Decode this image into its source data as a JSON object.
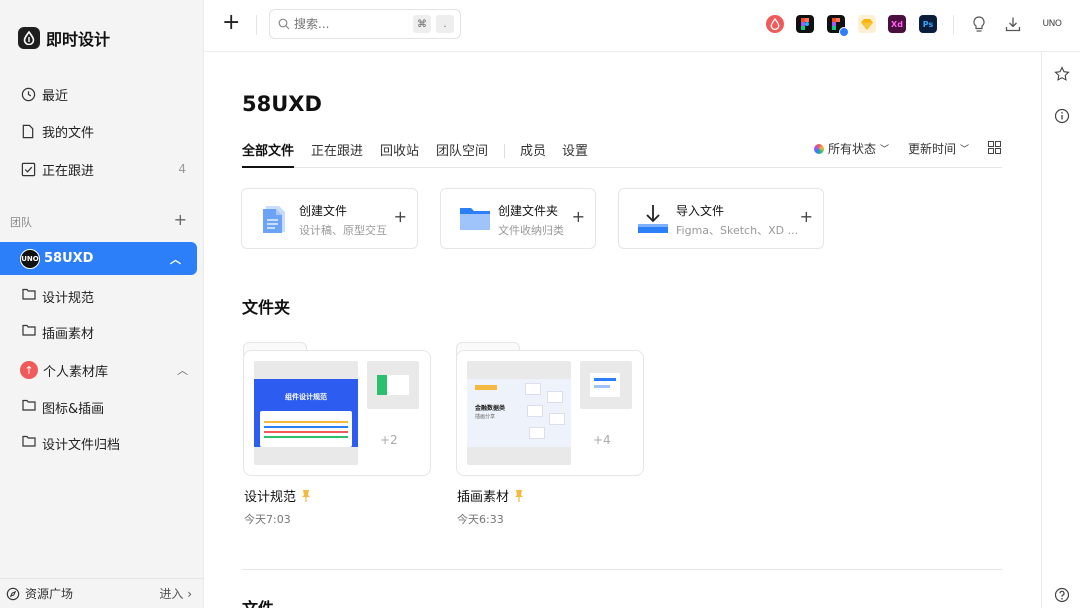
{
  "brand": {
    "name": "即时设计",
    "logo_icon": "drop-logo-icon"
  },
  "sidebar": {
    "nav": [
      {
        "label": "最近",
        "icon": "clock-icon"
      },
      {
        "label": "我的文件",
        "icon": "file-icon"
      },
      {
        "label": "正在跟进",
        "icon": "checkbox-icon",
        "count": "4"
      }
    ],
    "team_section_label": "团队",
    "team": {
      "name": "58UXD",
      "badge": "UNO"
    },
    "team_folders": [
      "设计规范",
      "插画素材"
    ],
    "personal": {
      "name": "个人素材库"
    },
    "personal_folders": [
      "图标&插画",
      "设计文件归档"
    ],
    "footer": {
      "label": "资源广场",
      "enter": "进入"
    }
  },
  "topbar": {
    "search_placeholder": "搜索...",
    "shortcut_keys": [
      "⌘",
      "."
    ],
    "apps": [
      {
        "name": "即时设计",
        "color": "#f05a5a",
        "text": ""
      },
      {
        "name": "Figma",
        "color": "#111111",
        "text": ""
      },
      {
        "name": "Figma-Plugin",
        "color": "#111111",
        "text": ""
      },
      {
        "name": "Sketch",
        "color": "#fbeed0",
        "text": ""
      },
      {
        "name": "Xd",
        "color": "#5a1a4f",
        "text": "Xd"
      },
      {
        "name": "Ps",
        "color": "#0b2545",
        "text": "Ps"
      }
    ],
    "user_badge": "UNO"
  },
  "main": {
    "title": "58UXD",
    "tabs": [
      "全部文件",
      "正在跟进",
      "回收站",
      "团队空间",
      "成员",
      "设置"
    ],
    "filters": {
      "status": "所有状态",
      "sort": "更新时间"
    },
    "create_cards": [
      {
        "title": "创建文件",
        "subtitle": "设计稿、原型交互"
      },
      {
        "title": "创建文件夹",
        "subtitle": "文件收纳归类"
      },
      {
        "title": "导入文件",
        "subtitle": "Figma、Sketch、XD ..."
      }
    ],
    "folders_heading": "文件夹",
    "folders": [
      {
        "name": "设计规范",
        "time": "今天7:03",
        "more": "+2",
        "preview_title": "组件设计规范"
      },
      {
        "name": "插画素材",
        "time": "今天6:33",
        "more": "+4",
        "preview_title": "金融数据类",
        "preview_sub": "插画分享"
      }
    ],
    "files_heading": "文件"
  },
  "colors": {
    "accent": "#2d7ff9",
    "pin": "#f5b841"
  }
}
